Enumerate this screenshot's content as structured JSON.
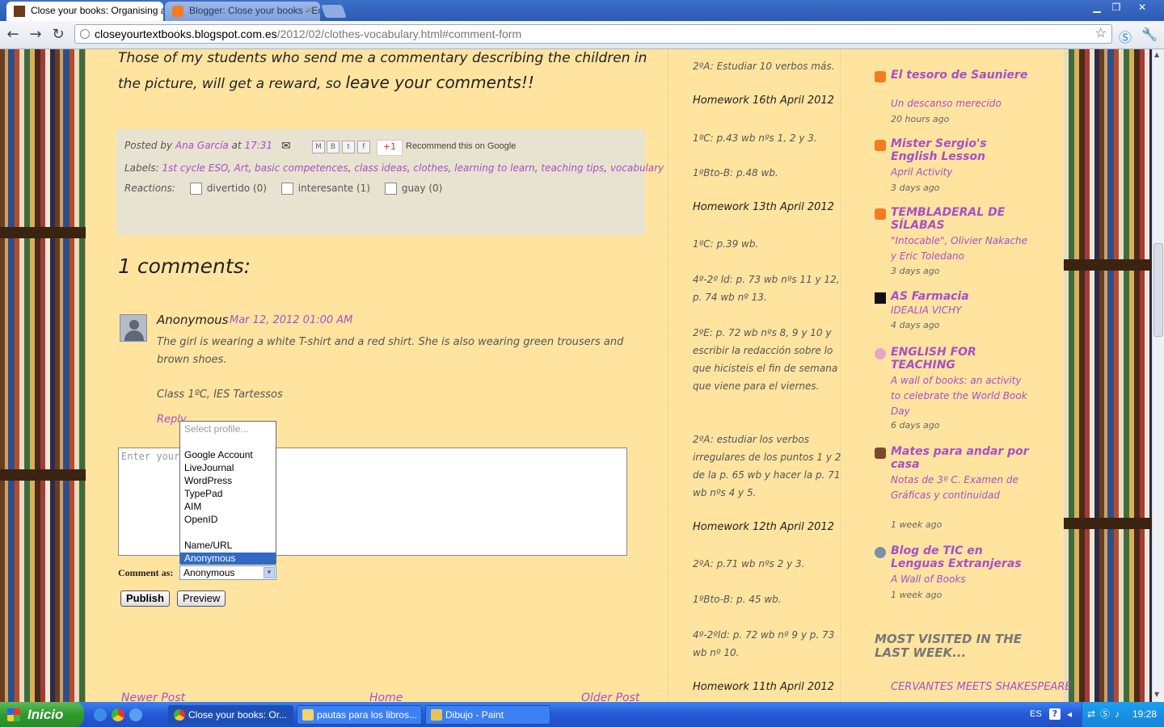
{
  "browser": {
    "tabs": [
      {
        "title": "Close your books: Organising a"
      },
      {
        "title": "Blogger: Close your books - Ec"
      }
    ],
    "url_host": "closeyourtextbooks.blogspot.com.es",
    "url_path": "/2012/02/clothes-vocabulary.html#comment-form"
  },
  "post": {
    "intro_text": "Those of my students who send me a commentary describing the children in the picture, will get a reward, so",
    "intro_emphasis": "leave your comments!!",
    "posted_by_label": "Posted by",
    "author": "Ana García",
    "at_label": "at",
    "time": "17:31",
    "share_recommend": "Recommend this on Google",
    "plus_one": "+1",
    "labels_label": "Labels:",
    "labels": [
      "1st cycle ESO",
      "Art",
      "basic competences",
      "class ideas",
      "clothes",
      "learning to learn",
      "teaching tips",
      "vocabulary"
    ],
    "reactions_label": "Reactions:",
    "reactions": [
      {
        "label": "divertido (0)"
      },
      {
        "label": "interesante (1)"
      },
      {
        "label": "guay (0)"
      }
    ]
  },
  "comments": {
    "title": "1 comments:",
    "items": [
      {
        "author": "Anonymous",
        "date": "Mar 12, 2012 01:00 AM",
        "body": "The girl is wearing a white T-shirt and a red shirt. She is also wearing green trousers and brown shoes.",
        "signature": "Class 1ºC, IES Tartessos"
      }
    ],
    "reply_label": "Reply",
    "textarea_placeholder": "Enter your comment...",
    "profile_options": [
      "Select profile...",
      "",
      "Google Account",
      "LiveJournal",
      "WordPress",
      "TypePad",
      "AIM",
      "OpenID",
      "",
      "Name/URL",
      "Anonymous"
    ],
    "selected_profile": "Anonymous",
    "comment_as_label": "Comment as:",
    "publish_label": "Publish",
    "preview_label": "Preview"
  },
  "pager": {
    "newer": "Newer Post",
    "home": "Home",
    "older": "Older Post"
  },
  "homework": {
    "line_2a_top": "2ºA: Estudiar 10 verbos más.",
    "h16": "Homework 16th April 2012",
    "h16_items": [
      "1ºC: p.43 wb nºs 1, 2 y 3.",
      "1ºBto-B: p.48 wb."
    ],
    "h13": "Homework 13th April 2012",
    "h13_items": [
      "1ºC: p.39 wb.",
      "4º-2º ld: p. 73 wb nºs 11 y 12, p. 74 wb nº 13.",
      "2ºE: p. 72 wb nºs 8, 9 y 10 y escribir la redacción sobre lo que hicisteis el fin de semana que viene para el viernes.",
      "2ºA: estudiar los verbos irregulares de los puntos 1 y 2 de la p. 65 wb y hacer la p. 71 wb nºs 4 y 5."
    ],
    "h12": "Homework 12th April 2012",
    "h12_items": [
      "2ºA: p.71 wb nºs 2 y 3.",
      "1ºBto-B: p. 45 wb.",
      "4º-2ºld: p. 72 wb nº 9 y p. 73 wb nº 10."
    ],
    "h11": "Homework 11th April 2012"
  },
  "bloglist": [
    {
      "title": "El tesoro de Sauniere",
      "post": "Un descanso merecido",
      "time": "20 hours ago"
    },
    {
      "title": "Mister Sergio's English Lesson",
      "post": "April Activity",
      "time": "3 days ago"
    },
    {
      "title": "TEMBLADERAL DE SÍLABAS",
      "post": "\"Intocable\", Olivier Nakache y Eric Toledano",
      "time": "3 days ago"
    },
    {
      "title": "AS Farmacia",
      "post": "IDEALIA VICHY",
      "time": "4 days ago"
    },
    {
      "title": "ENGLISH FOR TEACHING",
      "post": "A wall of books: an activity to celebrate the World Book Day",
      "time": "6 days ago"
    },
    {
      "title": "Mates para andar por casa",
      "post": "Notas de 3º C. Examen de Gráficas y continuidad",
      "time": "1 week ago"
    },
    {
      "title": "Blog de TIC en Lenguas Extranjeras",
      "post": "A Wall of Books",
      "time": "1 week ago"
    }
  ],
  "most_visited": {
    "title": "MOST VISITED IN THE LAST WEEK...",
    "first": "CERVANTES MEETS SHAKESPEARE"
  },
  "taskbar": {
    "start_label": "Inicio",
    "buttons": [
      {
        "label": "Close your books: Or..."
      },
      {
        "label": "pautas para los libros..."
      },
      {
        "label": "Dibujo - Paint"
      }
    ],
    "lang": "ES",
    "clock": "19:28"
  }
}
